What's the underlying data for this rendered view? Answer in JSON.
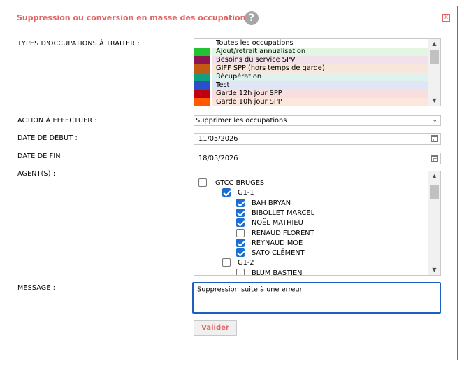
{
  "dialog": {
    "title": "Suppression ou conversion en masse des occupations",
    "help_icon": "?",
    "close_icon": "x"
  },
  "labels": {
    "types": "TYPES D'OCCUPATIONS À TRAITER :",
    "action": "ACTION À EFFECTUER :",
    "start": "DATE DE DÉBUT :",
    "end": "DATE DE FIN :",
    "agents": "AGENT(S) :",
    "message": "MESSAGE :"
  },
  "types": [
    {
      "label": "Toutes les occupations",
      "swatch": "#ffffff",
      "bg": "#ffffff"
    },
    {
      "label": "Ajout/retrait annualisation",
      "swatch": "#22c233",
      "bg": "#e3f6e3"
    },
    {
      "label": "Besoins du service SPV",
      "swatch": "#8c1450",
      "bg": "#f2e0ea"
    },
    {
      "label": "GIFF SPP (hors temps de garde)",
      "swatch": "#c25a14",
      "bg": "#f7e6db"
    },
    {
      "label": "Récupération",
      "swatch": "#10a080",
      "bg": "#dff2ed"
    },
    {
      "label": "Test",
      "swatch": "#2a4fc9",
      "bg": "#e1e6f7"
    },
    {
      "label": "Garde 12h jour SPP",
      "swatch": "#c00010",
      "bg": "#f8dede"
    },
    {
      "label": "Garde 10h jour SPP",
      "swatch": "#ff5a00",
      "bg": "#fde7dd"
    }
  ],
  "action": {
    "selected": "Supprimer les occupations"
  },
  "dates": {
    "start": "11/05/2026",
    "end": "18/05/2026"
  },
  "agents": [
    {
      "label": "GTCC BRUGES",
      "checked": false,
      "level": 0
    },
    {
      "label": "G1-1",
      "checked": true,
      "level": 1
    },
    {
      "label": "BAH BRYAN",
      "checked": true,
      "level": 2
    },
    {
      "label": "BIBOLLET MARCEL",
      "checked": true,
      "level": 2
    },
    {
      "label": "NOËL MATHIEU",
      "checked": true,
      "level": 2
    },
    {
      "label": "RENAUD FLORENT",
      "checked": false,
      "level": 2
    },
    {
      "label": "REYNAUD MOÉ",
      "checked": true,
      "level": 2
    },
    {
      "label": "SATO CLÉMENT",
      "checked": true,
      "level": 2
    },
    {
      "label": "G1-2",
      "checked": false,
      "level": 1
    },
    {
      "label": "BLUM BASTIEN",
      "checked": false,
      "level": 2
    }
  ],
  "message": {
    "value": "Suppression suite à une erreur"
  },
  "submit": {
    "label": "Valider"
  },
  "colors": {
    "accent": "#e06666",
    "focus": "#1d5fbf",
    "checkbox": "#1a6fd1"
  }
}
